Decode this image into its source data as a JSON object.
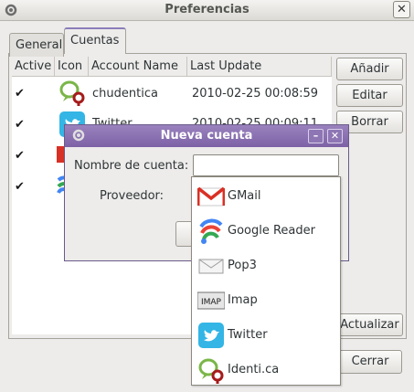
{
  "window": {
    "title": "Preferencias"
  },
  "tabs": [
    {
      "label": "General",
      "active": false
    },
    {
      "label": "Cuentas",
      "active": true
    }
  ],
  "accounts_table": {
    "columns": [
      "Active",
      "Icon",
      "Account Name",
      "Last Update"
    ],
    "rows": [
      {
        "active": true,
        "icon": "identica-icon",
        "name": "chudentica",
        "last_update": "2010-02-25 00:08:59"
      },
      {
        "active": true,
        "icon": "twitter-icon",
        "name": "Twitter",
        "last_update": "2010-02-25 00:09:11"
      },
      {
        "active": true,
        "icon": "gmail-icon",
        "name": "",
        "last_update": ""
      },
      {
        "active": true,
        "icon": "google-reader-icon",
        "name": "",
        "last_update": ""
      }
    ]
  },
  "buttons": {
    "add": "Añadir",
    "edit": "Editar",
    "delete": "Borrar",
    "update": "Actualizar",
    "close": "Cerrar"
  },
  "dialog": {
    "title": "Nueva cuenta",
    "name_label": "Nombre de cuenta:",
    "name_value": "",
    "provider_label": "Proveedor:"
  },
  "provider_options": [
    {
      "label": "GMail",
      "icon": "gmail-icon"
    },
    {
      "label": "Google Reader",
      "icon": "google-reader-icon"
    },
    {
      "label": "Pop3",
      "icon": "envelope-icon"
    },
    {
      "label": "Imap",
      "icon": "imap-icon"
    },
    {
      "label": "Twitter",
      "icon": "twitter-icon"
    },
    {
      "label": "Identi.ca",
      "icon": "identica-icon"
    }
  ],
  "colors": {
    "dialog_titlebar": "#8b70b3",
    "twitter": "#33b5e5",
    "identica_green": "#7ab648",
    "identica_red": "#a51b1b",
    "gmail_red": "#d93025"
  }
}
